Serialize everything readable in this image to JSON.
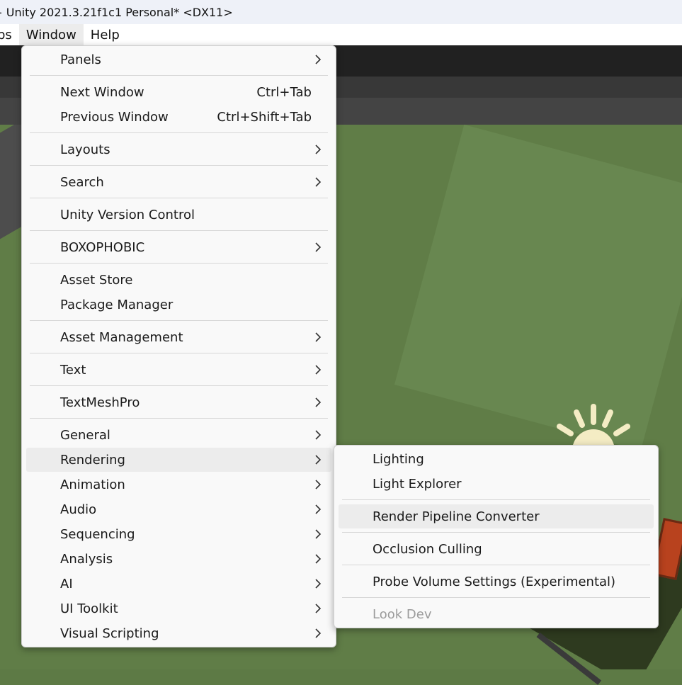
{
  "titlebar": {
    "dash": "-",
    "title": "Unity 2021.3.21f1c1 Personal* <DX11>"
  },
  "menubar": {
    "items": [
      "bs",
      "Window",
      "Help"
    ]
  },
  "window_menu": {
    "items": [
      {
        "label": "Panels",
        "submenu": true
      },
      {
        "label": "Next Window",
        "shortcut": "Ctrl+Tab"
      },
      {
        "label": "Previous Window",
        "shortcut": "Ctrl+Shift+Tab"
      },
      {
        "label": "Layouts",
        "submenu": true
      },
      {
        "label": "Search",
        "submenu": true
      },
      {
        "label": "Unity Version Control"
      },
      {
        "label": "BOXOPHOBIC",
        "submenu": true
      },
      {
        "label": "Asset Store"
      },
      {
        "label": "Package Manager"
      },
      {
        "label": "Asset Management",
        "submenu": true
      },
      {
        "label": "Text",
        "submenu": true
      },
      {
        "label": "TextMeshPro",
        "submenu": true
      },
      {
        "label": "General",
        "submenu": true
      },
      {
        "label": "Rendering",
        "submenu": true,
        "highlighted": true
      },
      {
        "label": "Animation",
        "submenu": true
      },
      {
        "label": "Audio",
        "submenu": true
      },
      {
        "label": "Sequencing",
        "submenu": true
      },
      {
        "label": "Analysis",
        "submenu": true
      },
      {
        "label": "AI",
        "submenu": true
      },
      {
        "label": "UI Toolkit",
        "submenu": true
      },
      {
        "label": "Visual Scripting",
        "submenu": true
      }
    ]
  },
  "rendering_submenu": {
    "items": [
      {
        "label": "Lighting"
      },
      {
        "label": "Light Explorer"
      },
      {
        "label": "Render Pipeline Converter",
        "highlighted": true
      },
      {
        "label": "Occlusion Culling"
      },
      {
        "label": "Probe Volume Settings (Experimental)"
      },
      {
        "label": "Look Dev",
        "disabled": true
      }
    ]
  },
  "colors": {
    "menu_bg": "#f9f9f9",
    "highlight": "#ececec",
    "scene_green": "#607d47",
    "disabled_text": "#9b9b9b"
  },
  "icons": {
    "submenu_arrow": "chevron-right-icon",
    "scene_light": "sun-gizmo-icon"
  }
}
